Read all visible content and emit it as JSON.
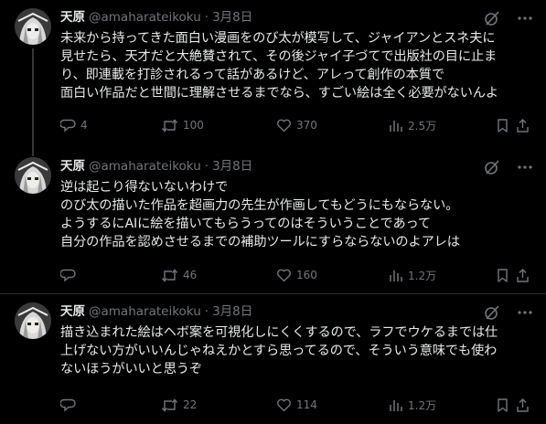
{
  "tweets": [
    {
      "name": "天原",
      "handle": "@amaharateikoku",
      "dot": "·",
      "date": "3月8日",
      "text": "未来から持ってきた面白い漫画をのび太が模写して、ジャイアンとスネ夫に\n見せたら、天才だと大絶賛されて、その後ジャイ子づてで出版社の目に止ま\nり、即連載を打診されるって話があるけど、アレって創作の本質で\n面白い作品だと世間に理解させるまでなら、すごい絵は全く必要がないんよ",
      "replies": "4",
      "retweets": "100",
      "likes": "370",
      "views": "2.5万"
    },
    {
      "name": "天原",
      "handle": "@amaharateikoku",
      "dot": "·",
      "date": "3月8日",
      "text": "逆は起こり得ないないわけで\nのび太の描いた作品を超画力の先生が作画してもどうにもならない。\nようするにAIに絵を描いてもらうってのはそういうことであって\n自分の作品を認めさせるまでの補助ツールにすらならないのよアレは",
      "replies": "",
      "retweets": "46",
      "likes": "160",
      "views": "1.2万"
    },
    {
      "name": "天原",
      "handle": "@amaharateikoku",
      "dot": "·",
      "date": "3月8日",
      "text": "描き込まれた絵はヘボ案を可視化しにくくするので、ラフでウケるまでは仕\n上げない方がいいんじゃねえかとすら思ってるので、そういう意味でも使わ\nないほうがいいと思うぞ",
      "replies": "",
      "retweets": "22",
      "likes": "114",
      "views": "1.2万"
    }
  ],
  "icons": {
    "grok": "grok-slash-icon",
    "more": "more-horizontal-icon",
    "reply": "reply-bubble-icon",
    "retweet": "retweet-arrows-icon",
    "like": "heart-icon",
    "views": "views-bars-icon",
    "bookmark": "bookmark-icon",
    "share": "share-upload-icon"
  },
  "colors": {
    "background": "#000000",
    "text": "#e7e9ea",
    "secondary": "#71767b",
    "divider": "#2f3336"
  }
}
